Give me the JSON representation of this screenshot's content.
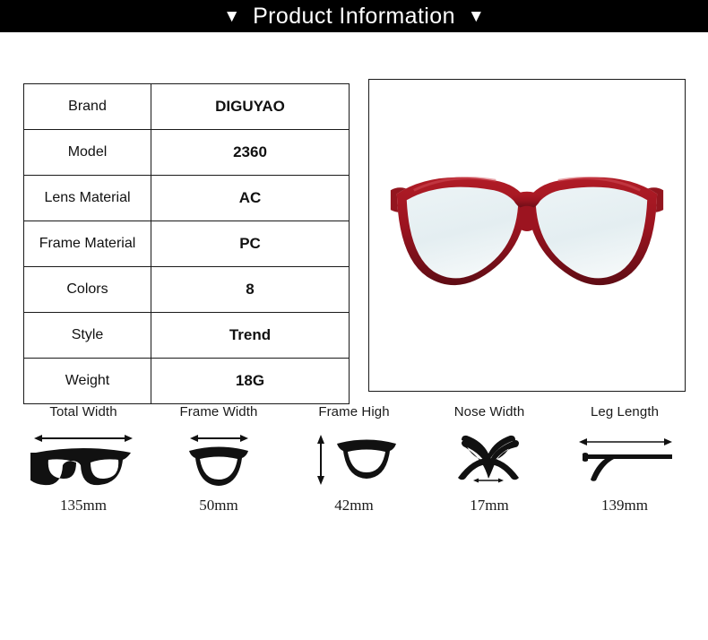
{
  "header": {
    "title": "Product Information",
    "left_marker": "▼",
    "right_marker": "▼",
    "background_color": "#000000",
    "text_color": "#ffffff"
  },
  "spec_table": {
    "rows": [
      {
        "key": "Brand",
        "value": "DIGUYAO"
      },
      {
        "key": "Model",
        "value": "2360"
      },
      {
        "key": "Lens Material",
        "value": "AC"
      },
      {
        "key": "Frame Material",
        "value": "PC"
      },
      {
        "key": "Colors",
        "value": "8"
      },
      {
        "key": "Style",
        "value": "Trend"
      },
      {
        "key": "Weight",
        "value": "18G"
      }
    ]
  },
  "product_image": {
    "alt": "red cat-eye eyeglasses front view",
    "frame_color": "#a3151f",
    "frame_color_dark": "#6d0f17",
    "lens_color": "#e9f1f4",
    "temple_color": "#7fada4",
    "background": "#ffffff"
  },
  "measurements": [
    {
      "label": "Total Width",
      "value": "135mm",
      "icon": "glasses-full-width-icon"
    },
    {
      "label": "Frame Width",
      "value": "50mm",
      "icon": "lens-width-icon"
    },
    {
      "label": "Frame High",
      "value": "42mm",
      "icon": "lens-height-icon"
    },
    {
      "label": "Nose Width",
      "value": "17mm",
      "icon": "nose-bridge-icon"
    },
    {
      "label": "Leg Length",
      "value": "139mm",
      "icon": "temple-arm-icon"
    }
  ]
}
